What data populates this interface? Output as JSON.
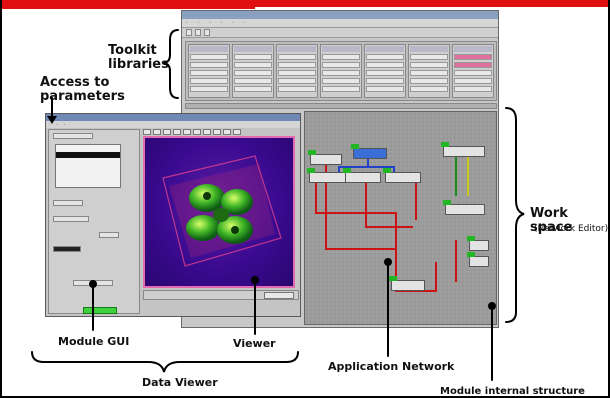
{
  "annotations": {
    "toolkit": "Toolkit\nlibraries",
    "access": "Access to\nparameters",
    "workspace": "Work space",
    "workspace_sub": "(Network Editor)",
    "module_gui": "Module GUI",
    "viewer": "Viewer",
    "data_viewer": "Data Viewer",
    "app_network": "Application Network",
    "module_internal": "Module internal structure"
  },
  "colors": {
    "accent_red": "#e01010",
    "viewer_bg": "#3a0a90",
    "wire_red": "#cc1212",
    "module_led": "#23b623"
  }
}
